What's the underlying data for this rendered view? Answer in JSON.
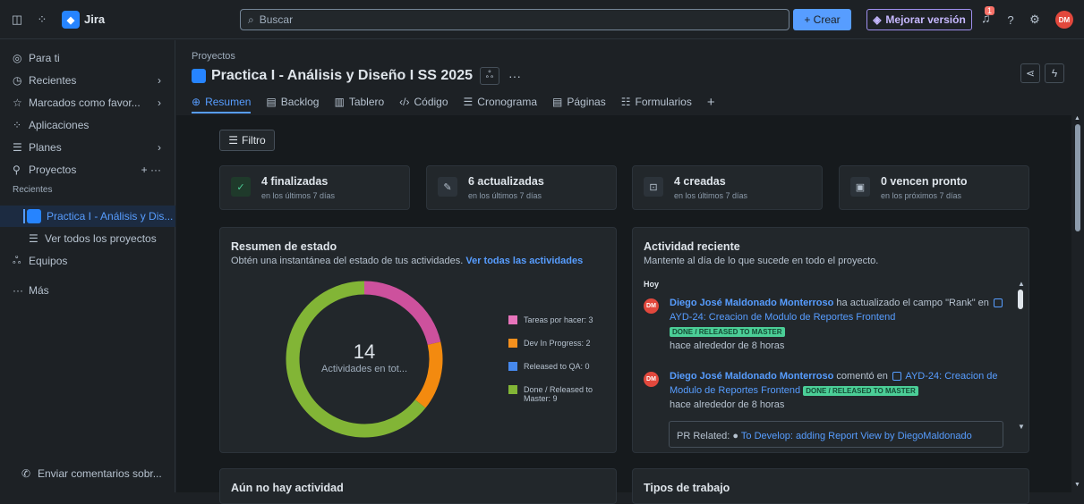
{
  "topbar": {
    "app_name": "Jira",
    "search_placeholder": "Buscar",
    "create_label": "+ Crear",
    "upgrade_label": "Mejorar versión",
    "notif_count": "1",
    "avatar_initials": "DM"
  },
  "sidebar": {
    "para_ti": "Para ti",
    "recientes": "Recientes",
    "marcados": "Marcados como favor...",
    "aplicaciones": "Aplicaciones",
    "planes": "Planes",
    "proyectos": "Proyectos",
    "recientes_header": "Recientes",
    "current_project": "Practica I - Análisis y Dis...",
    "ver_todos": "Ver todos los proyectos",
    "equipos": "Equipos",
    "mas": "Más",
    "feedback": "Enviar comentarios sobr..."
  },
  "header": {
    "breadcrumb": "Proyectos",
    "title": "Practica I - Análisis y Diseño I SS 2025",
    "tabs": [
      {
        "label": "Resumen",
        "icon": "globe-icon"
      },
      {
        "label": "Backlog",
        "icon": "backlog-icon"
      },
      {
        "label": "Tablero",
        "icon": "board-icon"
      },
      {
        "label": "Código",
        "icon": "code-icon"
      },
      {
        "label": "Cronograma",
        "icon": "timeline-icon"
      },
      {
        "label": "Páginas",
        "icon": "pages-icon"
      },
      {
        "label": "Formularios",
        "icon": "forms-icon"
      }
    ]
  },
  "filter_label": "Filtro",
  "stats": [
    {
      "title": "4 finalizadas",
      "sub": "en los últimos 7 días"
    },
    {
      "title": "6 actualizadas",
      "sub": "en los últimos 7 días"
    },
    {
      "title": "4 creadas",
      "sub": "en los últimos 7 días"
    },
    {
      "title": "0 vencen pronto",
      "sub": "en los próximos 7 días"
    }
  ],
  "status_summary": {
    "title": "Resumen de estado",
    "subtitle": "Obtén una instantánea del estado de tus actividades.",
    "link": "Ver todas las actividades",
    "total": "14",
    "total_label": "Actividades en tot...",
    "legend": [
      {
        "label": "Tareas por hacer: 3",
        "color": "#e774bb"
      },
      {
        "label": "Dev In Progress: 2",
        "color": "#f5901d"
      },
      {
        "label": "Released to QA: 0",
        "color": "#4688ec"
      },
      {
        "label": "Done / Released to Master: 9",
        "color": "#82b536"
      }
    ]
  },
  "chart_data": {
    "type": "pie",
    "categories": [
      "Tareas por hacer",
      "Dev In Progress",
      "Released to QA",
      "Done / Released to Master"
    ],
    "values": [
      3,
      2,
      0,
      9
    ],
    "colors": [
      "#cd519d",
      "#f38a0f",
      "#4688ec",
      "#82b536"
    ]
  },
  "activity": {
    "title": "Actividad reciente",
    "subtitle": "Mantente al día de lo que sucede en todo el proyecto.",
    "day": "Hoy",
    "items": [
      {
        "user": "Diego José Maldonado Monterroso",
        "action": "ha actualizado el campo \"Rank\" en",
        "issue": "AYD-24: Creacion de Modulo de Reportes Frontend",
        "status": "DONE / RELEASED TO MASTER",
        "time": "hace alrededor de 8 horas"
      },
      {
        "user": "Diego José Maldonado Monterroso",
        "action": "comentó en",
        "issue": "AYD-24: Creacion de Modulo de Reportes Frontend",
        "status": "DONE / RELEASED TO MASTER",
        "time": "hace alrededor de 8 horas"
      }
    ],
    "pr_label": "PR Related:",
    "pr_link": "To Develop: adding Report View by DiegoMaldonado"
  },
  "bottom": {
    "left_title": "Aún no hay actividad",
    "right_title": "Tipos de trabajo"
  }
}
